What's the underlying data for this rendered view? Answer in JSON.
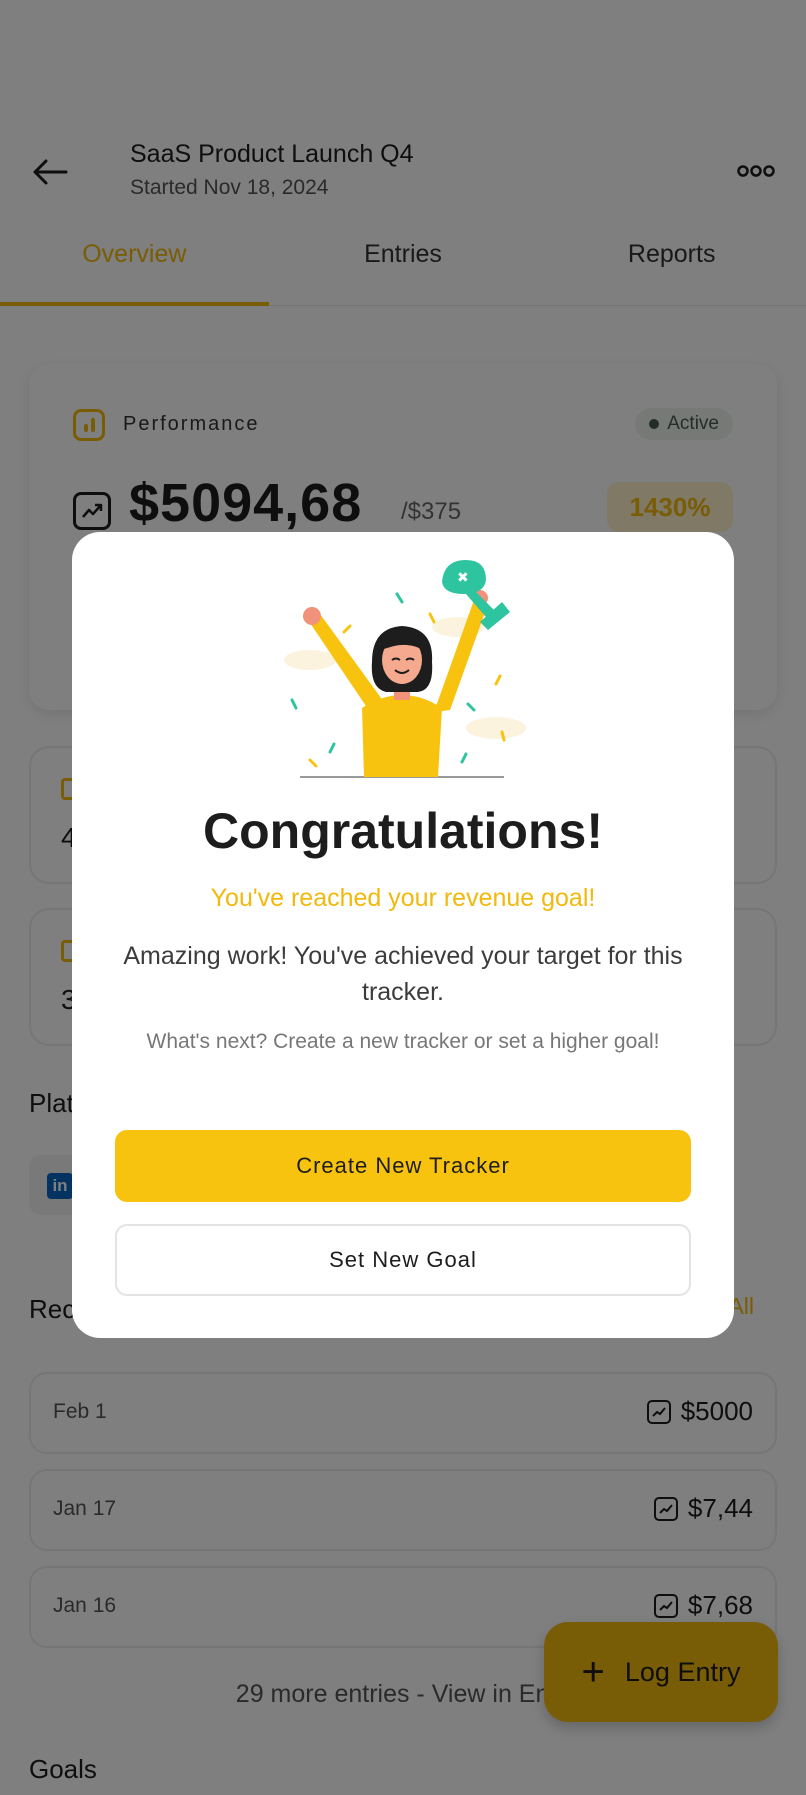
{
  "header": {
    "title": "SaaS Product Launch Q4",
    "subtitle": "Started Nov 18, 2024"
  },
  "tabs": [
    {
      "label": "Overview",
      "active": true
    },
    {
      "label": "Entries",
      "active": false
    },
    {
      "label": "Reports",
      "active": false
    }
  ],
  "performance": {
    "label": "Performance",
    "status": "Active",
    "amount": "$5094,68",
    "goal": "/$375",
    "percent": "1430%"
  },
  "stats": [
    {
      "value": "4"
    },
    {
      "value": "3"
    }
  ],
  "platforms": {
    "title": "Plat",
    "linkedin_icon": "in"
  },
  "recent": {
    "title": "Rec",
    "view_all": "All",
    "entries": [
      {
        "date": "Feb 1",
        "amount": "$5000"
      },
      {
        "date": "Jan 17",
        "amount": "$7,44"
      },
      {
        "date": "Jan 16",
        "amount": "$7,68"
      }
    ],
    "more": "29 more entries - View in Entri"
  },
  "goals": {
    "title": "Goals"
  },
  "fab": {
    "label": "Log Entry"
  },
  "modal": {
    "title": "Congratulations!",
    "subtitle": "You've reached your revenue goal!",
    "body": "Amazing work! You've achieved your target for this tracker.",
    "note": "What's next? Create a new tracker or set a higher goal!",
    "primary_button": "Create New Tracker",
    "secondary_button": "Set New Goal"
  },
  "colors": {
    "accent": "#f2b90c",
    "primary_button": "#f8c30e",
    "confetti_green": "#2ec4a0"
  }
}
